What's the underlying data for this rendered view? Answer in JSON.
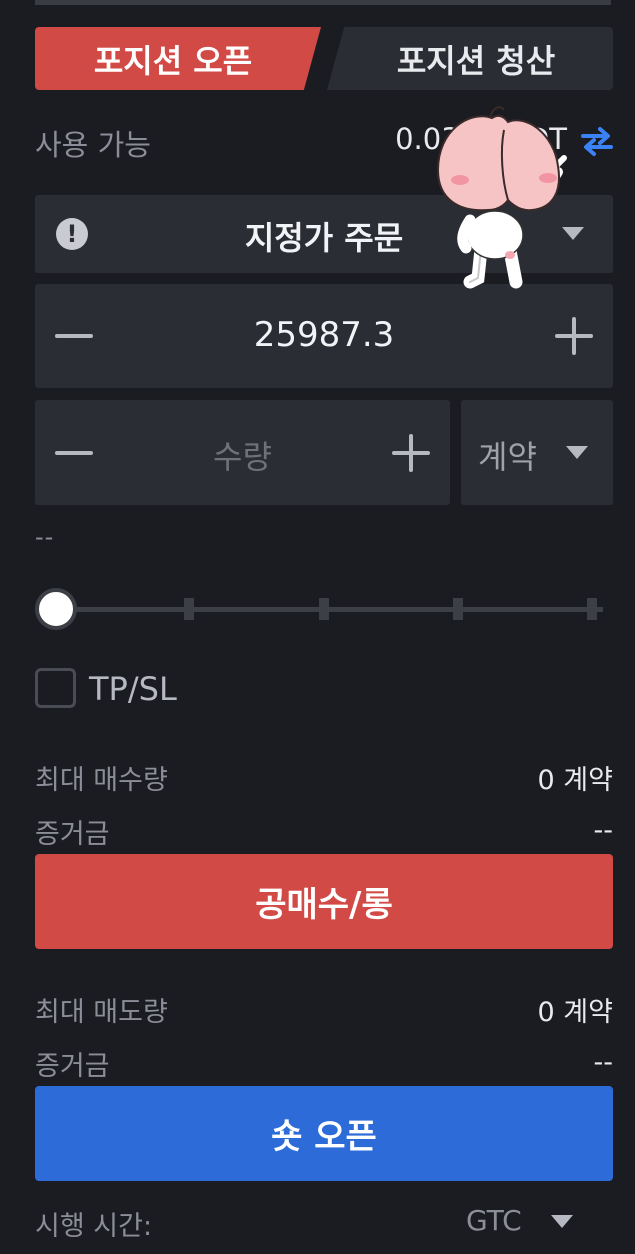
{
  "tabs": {
    "open_label": "포지션 오픈",
    "close_label": "포지션 청산"
  },
  "available": {
    "label": "사용 가능",
    "value": "0.032 USDT",
    "swap_icon": "swap-arrows-icon"
  },
  "order_type": {
    "info_icon": "info-icon",
    "info_glyph": "!",
    "label": "지정가 주문"
  },
  "price": {
    "value": "25987.3"
  },
  "quantity": {
    "placeholder": "수량",
    "unit": "계약"
  },
  "estimate_text": "--",
  "slider": {
    "value_percent": 0
  },
  "tpsl": {
    "label": "TP/SL",
    "checked": false
  },
  "long": {
    "max_label": "최대 매수량",
    "max_value": "0 계약",
    "margin_label": "증거금",
    "margin_value": "--",
    "button_label": "공매수/롱"
  },
  "short": {
    "max_label": "최대 매도량",
    "max_value": "0 계약",
    "margin_label": "증거금",
    "margin_value": "--",
    "button_label": "숏 오픈"
  },
  "time_in_force": {
    "label": "시행 시간:",
    "value": "GTC"
  },
  "colors": {
    "background": "#1b1c21",
    "panel": "#2b2d34",
    "long_red": "#d24a45",
    "short_blue": "#2d6bd8",
    "swap_blue": "#3b82f6",
    "muted_text": "#8b8e98"
  }
}
